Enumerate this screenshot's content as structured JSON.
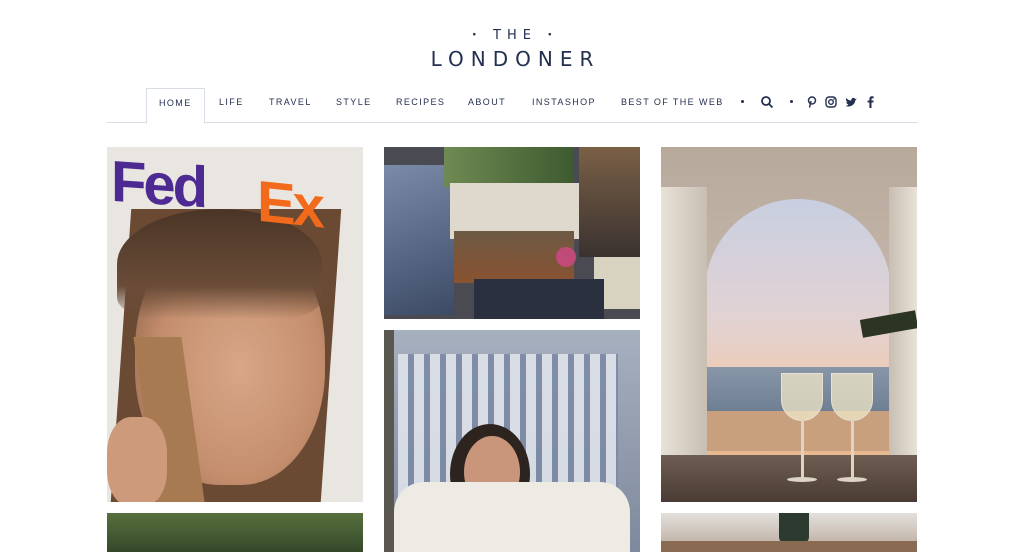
{
  "logo": {
    "the": "THE",
    "name": "LONDONER"
  },
  "nav": {
    "items": [
      {
        "label": "HOME",
        "active": true
      },
      {
        "label": "LIFE"
      },
      {
        "label": "TRAVEL"
      },
      {
        "label": "STYLE"
      },
      {
        "label": "RECIPES"
      },
      {
        "label": "ABOUT"
      },
      {
        "label": "INSTASHOP"
      },
      {
        "label": "BEST OF THE WEB"
      }
    ],
    "icons": [
      "search-icon",
      "pinterest-icon",
      "instagram-icon",
      "twitter-icon",
      "facebook-icon"
    ]
  },
  "colors": {
    "brand_navy": "#24304f",
    "border": "#d9dde6"
  },
  "tiles": {
    "t1_brand_left": "Fed",
    "t1_brand_right": "Ex"
  }
}
